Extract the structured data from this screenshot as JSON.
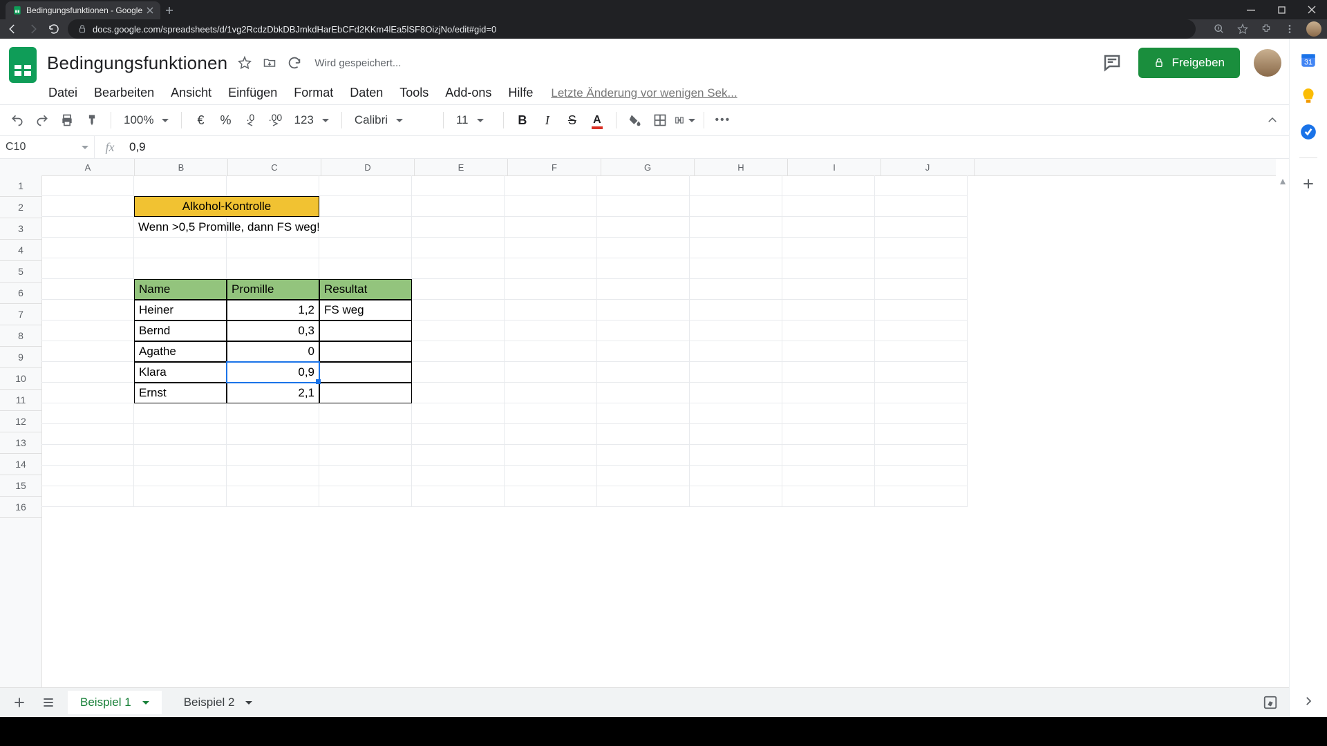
{
  "browser": {
    "tab_title": "Bedingungsfunktionen - Google",
    "url": "docs.google.com/spreadsheets/d/1vg2RcdzDbkDBJmkdHarEbCFd2KKm4lEa5lSF8OizjNo/edit#gid=0"
  },
  "doc": {
    "title": "Bedingungsfunktionen",
    "saving": "Wird gespeichert...",
    "last_change": "Letzte Änderung vor wenigen Sek...",
    "share": "Freigeben"
  },
  "menu": {
    "file": "Datei",
    "edit": "Bearbeiten",
    "view": "Ansicht",
    "insert": "Einfügen",
    "format": "Format",
    "data": "Daten",
    "tools": "Tools",
    "addons": "Add-ons",
    "help": "Hilfe"
  },
  "toolbar": {
    "zoom": "100%",
    "currency": "€",
    "percent": "%",
    "dec_less": ".0",
    "dec_more": ".00",
    "numfmt": "123",
    "font": "Calibri",
    "fontsize": "11",
    "more": "•••"
  },
  "fx": {
    "cell_ref": "C10",
    "formula": "0,9"
  },
  "columns": [
    "A",
    "B",
    "C",
    "D",
    "E",
    "F",
    "G",
    "H",
    "I",
    "J"
  ],
  "rows": [
    "1",
    "2",
    "3",
    "4",
    "5",
    "6",
    "7",
    "8",
    "9",
    "10",
    "11",
    "12",
    "13",
    "14",
    "15",
    "16"
  ],
  "sheet": {
    "title_merge": "Alkohol-Kontrolle",
    "rule": "Wenn >0,5 Promille, dann FS weg!",
    "headers": {
      "name": "Name",
      "promille": "Promille",
      "result": "Resultat"
    },
    "people": [
      {
        "name": "Heiner",
        "promille": "1,2",
        "result": "FS weg"
      },
      {
        "name": "Bernd",
        "promille": "0,3",
        "result": ""
      },
      {
        "name": "Agathe",
        "promille": "0",
        "result": ""
      },
      {
        "name": "Klara",
        "promille": "0,9",
        "result": ""
      },
      {
        "name": "Ernst",
        "promille": "2,1",
        "result": ""
      }
    ]
  },
  "tabs": {
    "active": "Beispiel 1",
    "other": "Beispiel 2"
  },
  "chart_data": {
    "type": "table",
    "title": "Alkohol-Kontrolle",
    "note": "Wenn >0,5 Promille, dann FS weg!",
    "columns": [
      "Name",
      "Promille",
      "Resultat"
    ],
    "rows": [
      [
        "Heiner",
        "1,2",
        "FS weg"
      ],
      [
        "Bernd",
        "0,3",
        ""
      ],
      [
        "Agathe",
        "0",
        ""
      ],
      [
        "Klara",
        "0,9",
        ""
      ],
      [
        "Ernst",
        "2,1",
        ""
      ]
    ]
  }
}
